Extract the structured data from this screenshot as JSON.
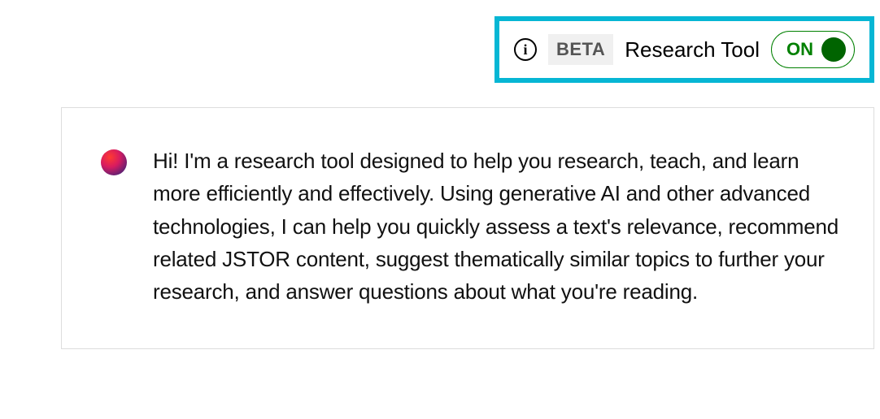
{
  "header": {
    "beta_badge": "BETA",
    "tool_label": "Research Tool",
    "toggle_state": "ON"
  },
  "message": {
    "text": "Hi! I'm a research tool designed to help you research, teach, and learn more efficiently and effectively. Using generative AI and other advanced technologies, I can help you quickly assess a text's relevance, recommend related JSTOR content, suggest thematically similar topics to further your research, and answer questions about what you're reading."
  }
}
